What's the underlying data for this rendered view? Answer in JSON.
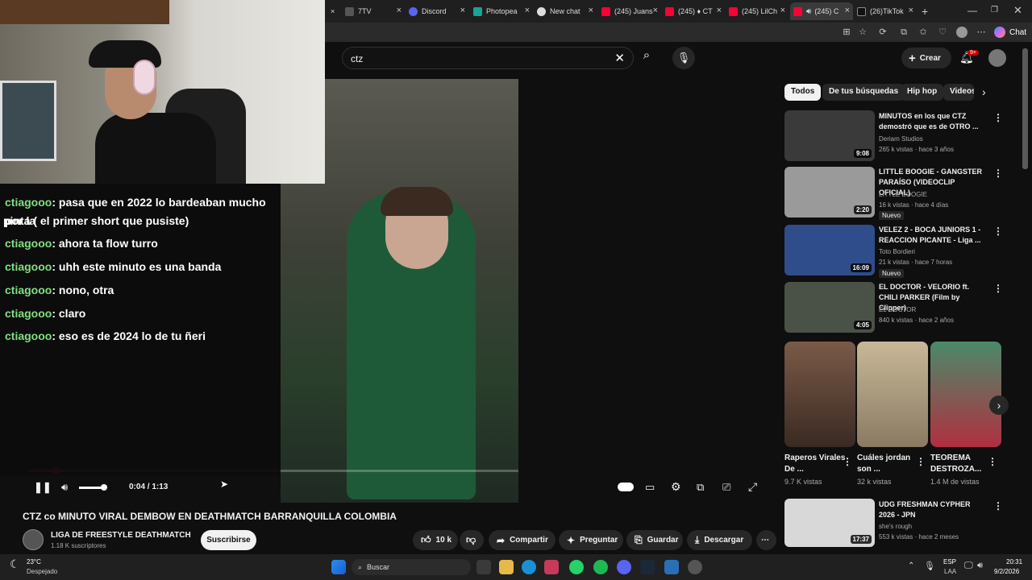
{
  "browser": {
    "tabs": [
      {
        "label": "7TV",
        "active": false
      },
      {
        "label": "Discord",
        "active": false
      },
      {
        "label": "Photopea",
        "active": false
      },
      {
        "label": "New chat",
        "active": false
      },
      {
        "label": "(245) Juans",
        "active": false
      },
      {
        "label": "(245) ♦ CT",
        "active": false
      },
      {
        "label": "(245) LilCh",
        "active": false
      },
      {
        "label": "(245) C",
        "active": true
      },
      {
        "label": "(26)TikTok",
        "active": false
      }
    ],
    "chat_button": "Chat"
  },
  "youtube": {
    "search": {
      "value": "ctz"
    },
    "create_label": "Crear",
    "notif_badge": "9+",
    "chips": [
      "Todos",
      "De tus búsquedas",
      "Hip hop",
      "Videos"
    ],
    "player": {
      "time": "0:04 / 1:13",
      "progress": 0.055
    },
    "video": {
      "title": "CTZ co MINUTO VIRAL DEMBOW EN DEATHMATCH BARRANQUILLA COLOMBIA",
      "channel": "LIGA DE FREESTYLE DEATHMATCH",
      "subs": "1.18 K suscriptores",
      "subscribe": "Suscribirse",
      "likes": "10 k",
      "share": "Compartir",
      "ask": "Preguntar",
      "save": "Guardar",
      "download": "Descargar"
    },
    "recs": [
      {
        "title": "MINUTOS en los que CTZ demostró que es de OTRO ...",
        "channel": "Deriam Studios",
        "meta": "265 k vistas · hace 3 años",
        "duration": "9:08",
        "badge": "",
        "color": "#3a3a3a"
      },
      {
        "title": "LITTLE BOOGIE - GANGSTER PARAÍSO (VIDEOCLIP OFICIAL)",
        "channel": "LITTLE BOOGIE",
        "meta": "16 k vistas · hace 4 días",
        "duration": "2:20",
        "badge": "Nuevo",
        "color": "#9a9a9a"
      },
      {
        "title": "VELEZ 2 - BOCA JUNIORS 1 - REACCION PICANTE - Liga ...",
        "channel": "Toto Bordieri",
        "meta": "21 k vistas · hace 7 horas",
        "duration": "16:09",
        "badge": "Nuevo",
        "color": "#2e4d8a"
      },
      {
        "title": "EL DOCTOR - VELORIO ft. CHILI PARKER (Film by Clipper)",
        "channel": "EL DOCTOR",
        "meta": "840 k vistas · hace 2 años",
        "duration": "4:05",
        "badge": "",
        "color": "#4a5247"
      }
    ],
    "shorts": [
      {
        "title": "Raperos Virales De ...",
        "views": "9.7 K vistas",
        "color": "#6a4a3a"
      },
      {
        "title": "Cuáles jordan son ...",
        "views": "32 k vistas",
        "color": "#b8a68a"
      },
      {
        "title": "TEOREMA DESTROZA...",
        "views": "1.4 M de vistas",
        "color": "#3b7a5a"
      }
    ],
    "last_rec": {
      "title": "UDG FRESHMAN CYPHER 2026 - JPN",
      "channel": "she's rough",
      "meta": "553 k vistas · hace 2 meses",
      "duration": "17:37",
      "color": "#d8d8d8"
    }
  },
  "chat": {
    "lines": [
      {
        "user": "ctiagooo",
        "text": ": pasa que en 2022 lo bardeaban mucho por la"
      },
      {
        "user": "",
        "text": "pinta ( el primer short que pusiste)"
      },
      {
        "user": "ctiagooo",
        "text": ": ahora ta flow turro"
      },
      {
        "user": "ctiagooo",
        "text": ": uhh este minuto es una banda"
      },
      {
        "user": "ctiagooo",
        "text": ": nono, otra"
      },
      {
        "user": "ctiagooo",
        "text": ": claro"
      },
      {
        "user": "ctiagooo",
        "text": ": eso es de 2024 lo de tu ñeri"
      }
    ]
  },
  "taskbar": {
    "weather_temp": "23°C",
    "weather_desc": "Despejado",
    "search_label": "Buscar",
    "lang": "ESP",
    "lang_sub": "LAA",
    "time": "20:31",
    "date": "9/2/2026"
  },
  "colors": {
    "accent": "#ff0033",
    "chat_user": "#7fe07f"
  }
}
